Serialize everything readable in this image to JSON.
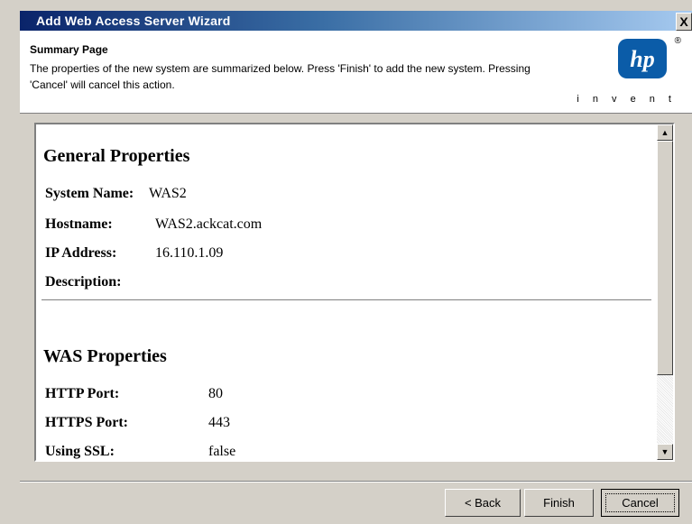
{
  "window": {
    "title": "Add Web Access Server Wizard",
    "close_label": "X"
  },
  "header": {
    "page_title": "Summary Page",
    "description": "The properties of the new system are summarized below. Press 'Finish' to add the new system. Pressing 'Cancel' will cancel this action.",
    "logo_text": "hp",
    "logo_tagline": "i n v e n t",
    "registered_mark": "®"
  },
  "summary": {
    "general": {
      "heading": "General Properties",
      "system_name_label": "System Name:",
      "system_name_value": "WAS2",
      "hostname_label": "Hostname:",
      "hostname_value": "WAS2.ackcat.com",
      "ip_label": "IP Address:",
      "ip_value": "16.110.1.09",
      "description_label": "Description:",
      "description_value": ""
    },
    "was": {
      "heading": "WAS Properties",
      "http_label": "HTTP Port:",
      "http_value": "80",
      "https_label": "HTTPS Port:",
      "https_value": "443",
      "ssl_label": "Using SSL:",
      "ssl_value": "false"
    }
  },
  "buttons": {
    "back": "< Back",
    "finish": "Finish",
    "cancel": "Cancel"
  },
  "colors": {
    "titlebar_start": "#0a246a",
    "titlebar_end": "#a6caf0",
    "dialog_face": "#d4d0c8",
    "hp_blue": "#0b5ca8"
  },
  "icons": [
    "close-icon",
    "hp-logo",
    "scroll-up-icon",
    "scroll-down-icon"
  ]
}
